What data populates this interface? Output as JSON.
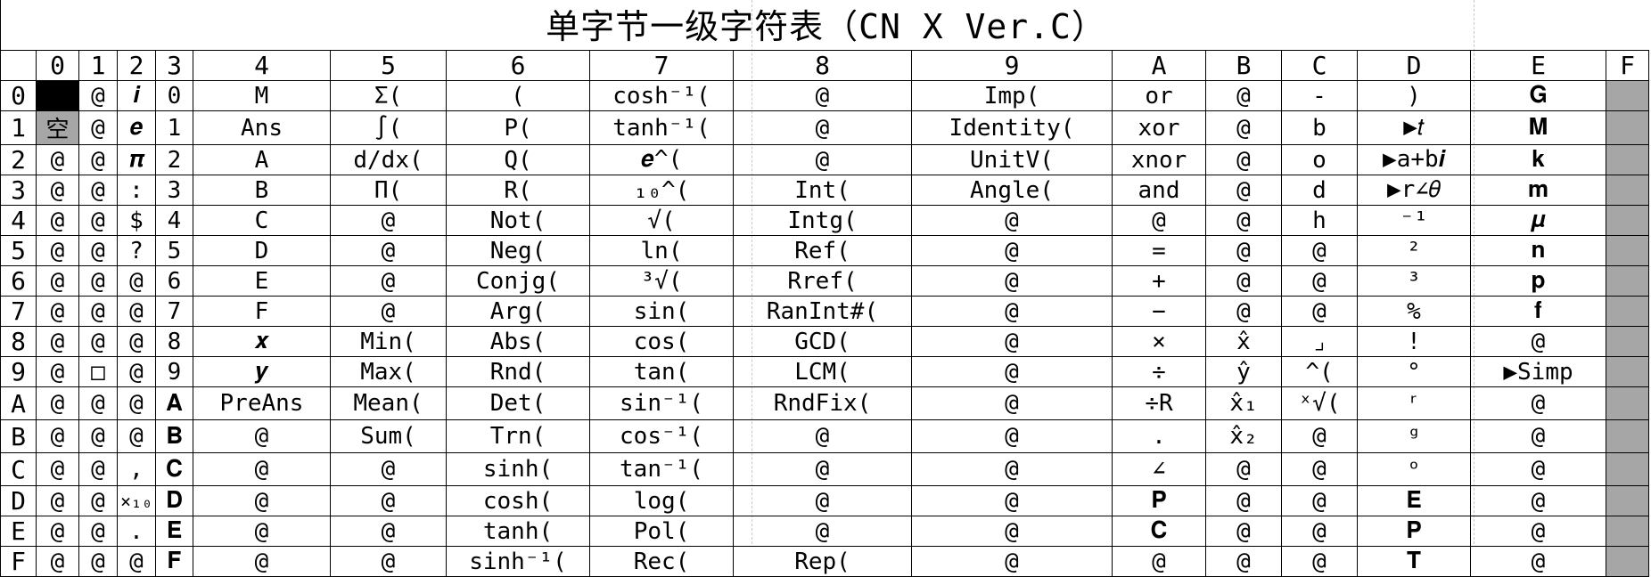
{
  "title": "单字节一级字符表（CN X Ver.C）",
  "columns": [
    "0",
    "1",
    "2",
    "3",
    "4",
    "5",
    "6",
    "7",
    "8",
    "9",
    "A",
    "B",
    "C",
    "D",
    "E",
    "F"
  ],
  "rows": [
    {
      "label": "0",
      "cells": [
        "",
        "@",
        "𝒊",
        "0",
        "M",
        "Σ(",
        "(",
        "cosh⁻¹(",
        "@",
        "Imp(",
        "or",
        "@",
        "-",
        ")",
        "𝐆",
        ""
      ]
    },
    {
      "label": "1",
      "cells": [
        "空",
        "@",
        "𝒆",
        "1",
        "Ans",
        "∫(",
        "P(",
        "tanh⁻¹(",
        "@",
        "Identity(",
        "xor",
        "@",
        "b",
        "▶𝑡",
        "𝐌",
        ""
      ]
    },
    {
      "label": "2",
      "cells": [
        "@",
        "@",
        "𝝅",
        "2",
        "A",
        "d/dx(",
        "Q(",
        "𝒆^(",
        "@",
        "UnitV(",
        "xnor",
        "@",
        "o",
        "▶a+b𝒊",
        "𝐤",
        ""
      ]
    },
    {
      "label": "3",
      "cells": [
        "@",
        "@",
        ":",
        "3",
        "B",
        "Π(",
        "R(",
        "₁₀^(",
        "Int(",
        "Angle(",
        "and",
        "@",
        "d",
        "▶r∠𝜃",
        "𝐦",
        ""
      ]
    },
    {
      "label": "4",
      "cells": [
        "@",
        "@",
        "$",
        "4",
        "C",
        "@",
        "Not(",
        "√(",
        "Intg(",
        "@",
        "@",
        "@",
        "h",
        "⁻¹",
        "𝝁",
        ""
      ]
    },
    {
      "label": "5",
      "cells": [
        "@",
        "@",
        "?",
        "5",
        "D",
        "@",
        "Neg(",
        "ln(",
        "Ref(",
        "@",
        "=",
        "@",
        "@",
        "²",
        "𝐧",
        ""
      ]
    },
    {
      "label": "6",
      "cells": [
        "@",
        "@",
        "@",
        "6",
        "E",
        "@",
        "Conjg(",
        "³√(",
        "Rref(",
        "@",
        "+",
        "@",
        "@",
        "³",
        "𝐩",
        ""
      ]
    },
    {
      "label": "7",
      "cells": [
        "@",
        "@",
        "@",
        "7",
        "F",
        "@",
        "Arg(",
        "sin(",
        "RanInt#(",
        "@",
        "−",
        "@",
        "@",
        "%",
        "𝐟",
        ""
      ]
    },
    {
      "label": "8",
      "cells": [
        "@",
        "@",
        "@",
        "8",
        "𝒙",
        "Min(",
        "Abs(",
        "cos(",
        "GCD(",
        "@",
        "×",
        "x̂",
        "⌟",
        "!",
        "@",
        ""
      ]
    },
    {
      "label": "9",
      "cells": [
        "@",
        "□",
        "@",
        "9",
        "𝒚",
        "Max(",
        "Rnd(",
        "tan(",
        "LCM(",
        "@",
        "÷",
        "ŷ",
        "^(",
        "°",
        "▶Simp",
        ""
      ]
    },
    {
      "label": "A",
      "cells": [
        "@",
        "@",
        "@",
        "𝐀",
        "PreAns",
        "Mean(",
        "Det(",
        "sin⁻¹(",
        "RndFix(",
        "@",
        "÷R",
        "x̂₁",
        "ˣ√(",
        "ʳ",
        "@",
        ""
      ]
    },
    {
      "label": "B",
      "cells": [
        "@",
        "@",
        "@",
        "𝐁",
        "@",
        "Sum(",
        "Trn(",
        "cos⁻¹(",
        "@",
        "@",
        ".",
        "x̂₂",
        "@",
        "ᵍ",
        "@",
        ""
      ]
    },
    {
      "label": "C",
      "cells": [
        "@",
        "@",
        ",",
        "𝐂",
        "@",
        "@",
        "sinh(",
        "tan⁻¹(",
        "@",
        "@",
        "∠",
        "@",
        "@",
        "ᵒ",
        "@",
        ""
      ]
    },
    {
      "label": "D",
      "cells": [
        "@",
        "@",
        "×₁₀",
        "𝐃",
        "@",
        "@",
        "cosh(",
        "log(",
        "@",
        "@",
        "𝐏",
        "@",
        "@",
        "𝐄",
        "@",
        ""
      ]
    },
    {
      "label": "E",
      "cells": [
        "@",
        "@",
        ".",
        "𝐄",
        "@",
        "@",
        "tanh(",
        "Pol(",
        "@",
        "@",
        "𝐂",
        "@",
        "@",
        "𝐏",
        "@",
        ""
      ]
    },
    {
      "label": "F",
      "cells": [
        "@",
        "@",
        "@",
        "𝐅",
        "@",
        "@",
        "sinh⁻¹(",
        "Rec(",
        "Rep(",
        "@",
        "@",
        "@",
        "@",
        "𝐓",
        "@",
        ""
      ]
    }
  ],
  "colors": {
    "selected": "#000000",
    "unused": "#a6a6a6",
    "grid": "#000000"
  }
}
